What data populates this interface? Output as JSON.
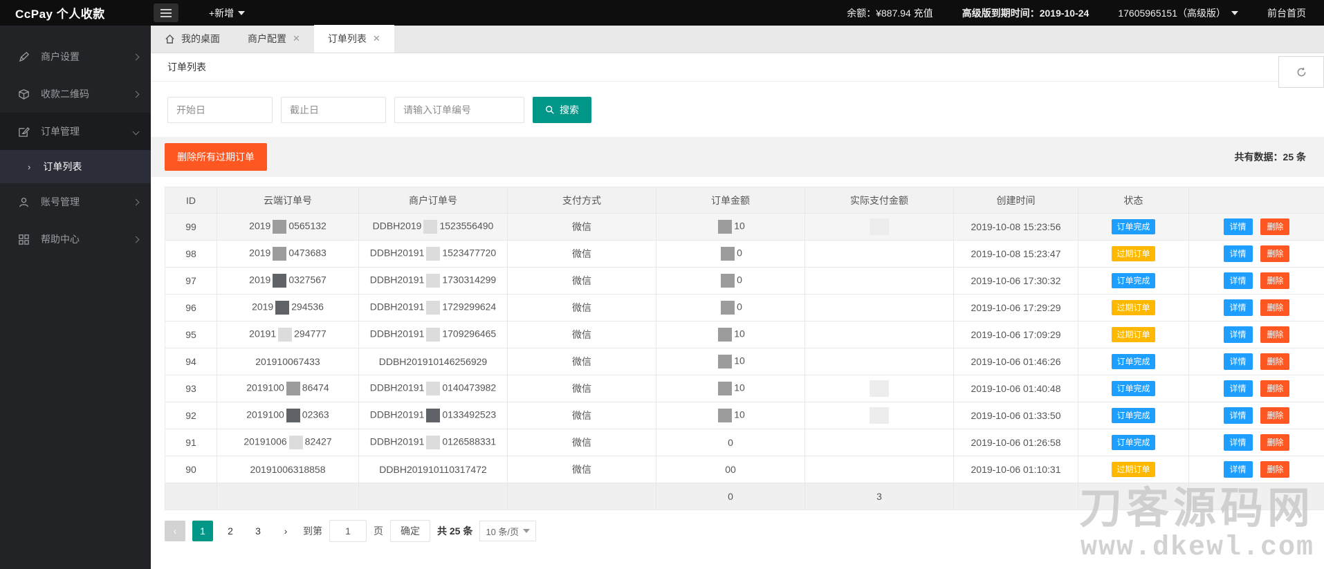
{
  "topbar": {
    "brand": "CcPay 个人收款",
    "add_new": "+新增",
    "balance": "余额：¥887.94",
    "recharge": "充值",
    "expiry": "高级版到期时间：2019-10-24",
    "account": "17605965151（高级版）",
    "front_home": "前台首页"
  },
  "sidebar": {
    "items": [
      {
        "label": "商户设置",
        "icon": "pen-icon"
      },
      {
        "label": "收款二维码",
        "icon": "qrcode-icon"
      },
      {
        "label": "订单管理",
        "icon": "order-edit-icon"
      },
      {
        "label": "账号管理",
        "icon": "user-icon"
      },
      {
        "label": "帮助中心",
        "icon": "help-grid-icon"
      }
    ],
    "active_sub_item": "订单列表",
    "sub_arrow": "›"
  },
  "tabs": [
    {
      "label": "我的桌面",
      "closable": false
    },
    {
      "label": "商户配置",
      "closable": true
    },
    {
      "label": "订单列表",
      "closable": true
    }
  ],
  "tab_close_glyph": "✕",
  "page": {
    "title": "订单列表"
  },
  "search": {
    "start_placeholder": "开始日",
    "end_placeholder": "截止日",
    "order_placeholder": "请输入订单编号",
    "button_label": "搜索"
  },
  "toolbar": {
    "delete_expired_label": "删除所有过期订单",
    "total_text": "共有数据：25 条"
  },
  "table": {
    "headers": [
      "ID",
      "云端订单号",
      "商户订单号",
      "支付方式",
      "订单金额",
      "实际支付金额",
      "创建时间",
      "状态",
      ""
    ],
    "rows": [
      {
        "id": "99",
        "cloud_prefix": "2019",
        "cloud_suffix": "0565132",
        "merchant_prefix": "DDBH2019",
        "merchant_suffix": "1523556490",
        "pay": "微信",
        "amount": "10",
        "time": "2019-10-08 15:23:56",
        "status": "订单完成",
        "masks": {
          "cloud": "gray",
          "merchant": "light",
          "amount": "gray",
          "paid": "faint"
        },
        "highlight": true
      },
      {
        "id": "98",
        "cloud_prefix": "2019",
        "cloud_suffix": "0473683",
        "merchant_prefix": "DDBH20191",
        "merchant_suffix": "1523477720",
        "pay": "微信",
        "amount": "0",
        "time": "2019-10-08 15:23:47",
        "status": "过期订单",
        "masks": {
          "cloud": "gray",
          "merchant": "light",
          "amount": "gray",
          "paid": "none"
        },
        "highlight": false
      },
      {
        "id": "97",
        "cloud_prefix": "2019",
        "cloud_suffix": "0327567",
        "merchant_prefix": "DDBH20191",
        "merchant_suffix": "1730314299",
        "pay": "微信",
        "amount": "0",
        "time": "2019-10-06 17:30:32",
        "status": "订单完成",
        "masks": {
          "cloud": "dark",
          "merchant": "light",
          "amount": "gray",
          "paid": "none"
        },
        "highlight": false
      },
      {
        "id": "96",
        "cloud_prefix": "2019",
        "cloud_suffix": "294536",
        "merchant_prefix": "DDBH20191",
        "merchant_suffix": "1729299624",
        "pay": "微信",
        "amount": "0",
        "time": "2019-10-06 17:29:29",
        "status": "过期订单",
        "masks": {
          "cloud": "dark",
          "merchant": "light",
          "amount": "gray",
          "paid": "none"
        },
        "highlight": false
      },
      {
        "id": "95",
        "cloud_prefix": "20191",
        "cloud_suffix": "294777",
        "merchant_prefix": "DDBH20191",
        "merchant_suffix": "1709296465",
        "pay": "微信",
        "amount": "10",
        "time": "2019-10-06 17:09:29",
        "status": "过期订单",
        "masks": {
          "cloud": "light",
          "merchant": "light",
          "amount": "gray",
          "paid": "none"
        },
        "highlight": false
      },
      {
        "id": "94",
        "cloud_prefix": "2019100",
        "cloud_suffix": "67433",
        "merchant_prefix": "DDBH20191",
        "merchant_suffix": "0146256929",
        "pay": "微信",
        "amount": "10",
        "time": "2019-10-06 01:46:26",
        "status": "订单完成",
        "masks": {
          "cloud": "none",
          "merchant": "none",
          "amount": "gray",
          "paid": "none"
        },
        "highlight": false
      },
      {
        "id": "93",
        "cloud_prefix": "2019100",
        "cloud_suffix": "86474",
        "merchant_prefix": "DDBH20191",
        "merchant_suffix": "0140473982",
        "pay": "微信",
        "amount": "10",
        "time": "2019-10-06 01:40:48",
        "status": "订单完成",
        "masks": {
          "cloud": "gray",
          "merchant": "light",
          "amount": "gray",
          "paid": "faint"
        },
        "highlight": false
      },
      {
        "id": "92",
        "cloud_prefix": "2019100",
        "cloud_suffix": "02363",
        "merchant_prefix": "DDBH20191",
        "merchant_suffix": "0133492523",
        "pay": "微信",
        "amount": "10",
        "time": "2019-10-06 01:33:50",
        "status": "订单完成",
        "masks": {
          "cloud": "dark",
          "merchant": "dark",
          "amount": "gray",
          "paid": "faint"
        },
        "highlight": false
      },
      {
        "id": "91",
        "cloud_prefix": "20191006",
        "cloud_suffix": "82427",
        "merchant_prefix": "DDBH20191",
        "merchant_suffix": "0126588331",
        "pay": "微信",
        "amount": "0",
        "time": "2019-10-06 01:26:58",
        "status": "订单完成",
        "masks": {
          "cloud": "light",
          "merchant": "light",
          "amount": "none",
          "paid": "none"
        },
        "highlight": false
      },
      {
        "id": "90",
        "cloud_prefix": "20191006",
        "cloud_suffix": "318858",
        "merchant_prefix": "DDBH20191",
        "merchant_suffix": "0110317472",
        "pay": "微信",
        "amount": "00",
        "time": "2019-10-06 01:10:31",
        "status": "过期订单",
        "masks": {
          "cloud": "none",
          "merchant": "none",
          "amount": "none",
          "paid": "none"
        },
        "highlight": false
      }
    ],
    "summary": {
      "amount": "0",
      "paid": "3"
    }
  },
  "status_styles": {
    "订单完成": "#1e9fff",
    "过期订单": "#ffb800"
  },
  "row_actions": {
    "detail": "详情",
    "delete": "删除"
  },
  "pagination": {
    "prev_glyph": "‹",
    "next_glyph": "›",
    "pages": [
      "1",
      "2",
      "3"
    ],
    "current": "1",
    "goto_label": "到第",
    "goto_value": "1",
    "page_unit": "页",
    "confirm_label": "确定",
    "total_label": "共 25 条",
    "per_page": "10 条/页"
  },
  "watermark": {
    "line1": "刀客源码网",
    "line2": "www.dkewl.com"
  },
  "colors": {
    "accent_teal": "#009688",
    "danger_orange": "#ff5722",
    "info_blue": "#1e9fff",
    "warn_yellow": "#ffb800"
  }
}
